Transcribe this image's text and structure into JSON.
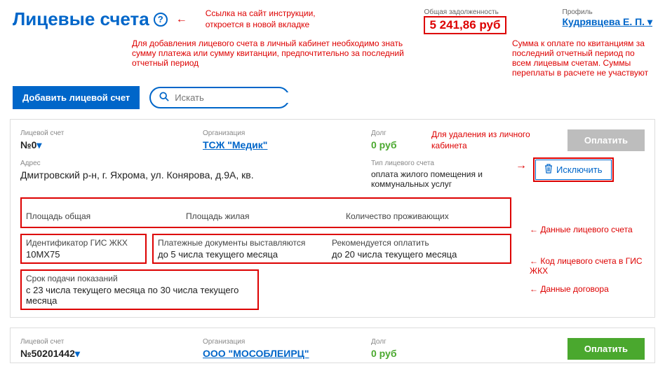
{
  "page": {
    "title": "Лицевые счета",
    "help_tooltip": "?"
  },
  "annotations": {
    "help_link": "Ссылка на сайт инструкции,\nоткроется в новой вкладке",
    "add_note": "Для добавления лицевого счета в личный кабинет необходимо знать\nсумму платежа или сумму квитанции, предпочтительно за последний отчетный период",
    "debt_note": "Сумма к оплате по квитанциям за последний отчетный период по всем лицевым счетам. Суммы переплаты в расчете не участвуют",
    "exclude_note": "Для удаления из личного кабинета",
    "data_account": "Данные лицевого счета",
    "gis_code": "Код лицевого счета в ГИС ЖКХ",
    "contract_data": "Данные договора"
  },
  "debt": {
    "label": "Общая задолженность",
    "value": "5 241,86 руб"
  },
  "profile": {
    "label": "Профиль",
    "name": "Кудрявцева Е. П."
  },
  "actions": {
    "add_button": "Добавить лицевой счет",
    "search_placeholder": "Искать"
  },
  "account1": {
    "ls_label": "Лицевой счет",
    "ls_value": "№0",
    "org_label": "Организация",
    "org_value": "ТСЖ \"Медик\"",
    "debt_label": "Долг",
    "debt_value": "0 руб",
    "addr_label": "Адрес",
    "addr_value": "Дмитровский р-н, г. Яхрома, ул. Конярова, д.9А, кв.",
    "type_label": "Тип лицевого счета",
    "type_value": "оплата жилого помещения и коммунальных услуг",
    "pay_btn": "Оплатить",
    "exclude_btn": "Исключить",
    "area_total": "Площадь общая",
    "area_living": "Площадь жилая",
    "residents": "Количество проживающих",
    "gis_label": "Идентификатор ГИС ЖКХ",
    "gis_value": "10МХ75",
    "paydoc_label": "Платежные документы выставляются",
    "paydoc_value": "до 5 числа текущего месяца",
    "payrec_label": "Рекомендуется оплатить",
    "payrec_value": "до 20 числа текущего месяца",
    "meter_label": "Срок подачи показаний",
    "meter_value": "с 23 числа текущего месяца по 30 числа текущего месяца"
  },
  "account2": {
    "ls_label": "Лицевой счет",
    "ls_value": "№50201442",
    "org_label": "Организация",
    "org_value": "ООО \"МОСОБЛЕИРЦ\"",
    "debt_label": "Долг",
    "debt_value": "0 руб",
    "pay_btn": "Оплатить"
  }
}
